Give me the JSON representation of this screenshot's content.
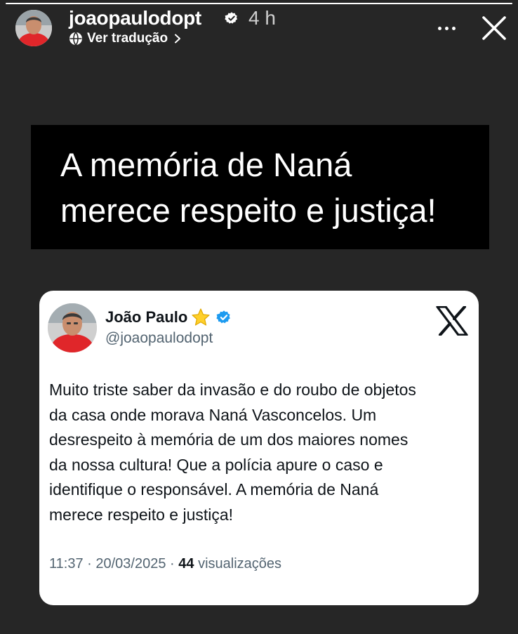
{
  "story": {
    "progress": 1.0,
    "username": "joaopaulodopt",
    "time_ago": "4 h",
    "translate_label": "Ver tradução"
  },
  "banner": {
    "line1": "A memória de Naná",
    "line2": "merece respeito e justiça!"
  },
  "tweet": {
    "author_name": "João Paulo",
    "handle": "@joaopaulodopt",
    "text_lines": [
      "Muito triste saber da invasão e do roubo de objetos",
      "da casa onde morava Naná Vasconcelos. Um",
      "desrespeito à memória de um dos maiores nomes",
      "da nossa cultura! Que a polícia apure o caso e",
      "identifique o responsável. A memória de Naná",
      "merece respeito e justiça!"
    ],
    "time": "11:37",
    "date": "20/03/2025",
    "separator": "·",
    "views_count": "44",
    "views_label": "visualizações"
  },
  "icons": {
    "verified_badge": "verified-icon",
    "translate": "globe-icon",
    "chevron": "chevron-right-icon",
    "more": "more-options-icon",
    "close": "close-icon",
    "star": "star-icon",
    "x_logo": "x-logo-icon"
  },
  "colors": {
    "background": "#262626",
    "banner": "#000000",
    "card": "#ffffff",
    "verified_blue": "#1d9bf0",
    "secondary_text": "#536471"
  }
}
